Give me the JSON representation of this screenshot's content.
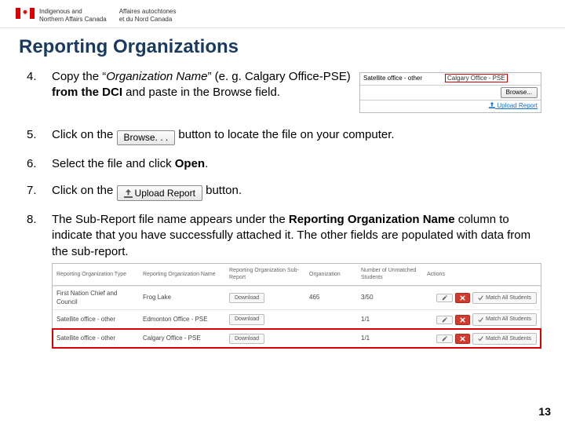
{
  "header": {
    "dept_en_1": "Indigenous and",
    "dept_en_2": "Northern Affairs Canada",
    "dept_fr_1": "Affaires autochtones",
    "dept_fr_2": "et du Nord Canada"
  },
  "title": "Reporting Organizations",
  "step4": {
    "n": "4.",
    "pre": "Copy the “",
    "org": "Organization Name",
    "post": "” (e. g. Calgary Office-PSE)",
    "tail_b": " from the DCI",
    "tail": " and paste in the Browse field."
  },
  "mini": {
    "sat": "Satellite office - other",
    "org": "Calgary Office - PSE",
    "browse": "Browse...",
    "upload": "Upload Report"
  },
  "step5": {
    "n": "5.",
    "a": "Click on the ",
    "btn": "Browse. . .",
    "b": " button to locate the file on your computer."
  },
  "step6": {
    "n": "6.",
    "a": "Select the file and click ",
    "open": "Open",
    "dot": "."
  },
  "step7": {
    "n": "7.",
    "a": "Click on the ",
    "btn": "Upload Report",
    "b": " button."
  },
  "step8": {
    "n": "8.",
    "a": "The Sub-Report file name appears under the ",
    "ron": "Reporting Organization Name",
    "b": " column to indicate that you have successfully attached it. The other fields are populated with data from the sub-report."
  },
  "table": {
    "h": [
      "Reporting Organization Type",
      "Reporting Organization Name",
      "Reporting Organization Sub-Report",
      "Organization",
      "Number of Unmatched Students",
      "Actions"
    ],
    "r": [
      {
        "c": [
          "First Nation Chief and Council",
          "Frog Lake",
          "Download",
          "465",
          "3/50"
        ],
        "match": "Match All Students"
      },
      {
        "c": [
          "Satellite office - other",
          "Edmonton Office - PSE",
          "Download",
          "",
          "1/1"
        ],
        "match": "Match All Students"
      },
      {
        "c": [
          "Satellite office - other",
          "Calgary Office - PSE",
          "Download",
          "",
          "1/1"
        ],
        "match": "Match All Students",
        "hl": true
      }
    ]
  },
  "page": "13"
}
